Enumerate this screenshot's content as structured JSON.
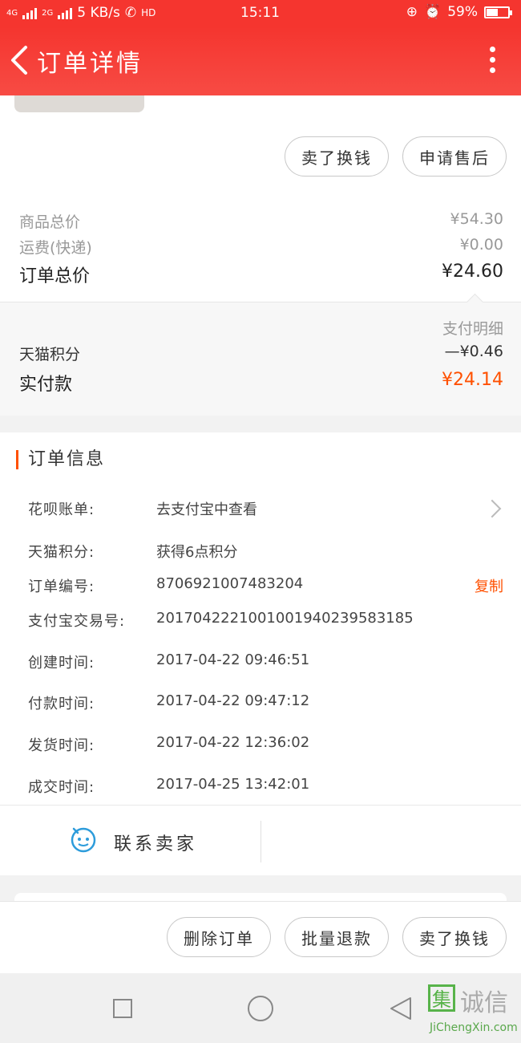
{
  "status": {
    "net": "4G",
    "net2": "2G",
    "speed": "5 KB/s",
    "hd": "HD",
    "time": "15:11",
    "battery": "59%",
    "battery_level": 0.59
  },
  "nav": {
    "title": "订单详情"
  },
  "actions_top": {
    "sell": "卖了换钱",
    "after_sale": "申请售后"
  },
  "prices": {
    "goods_total_label": "商品总价",
    "goods_total": "¥54.30",
    "shipping_label": "运费(快递)",
    "shipping": "¥0.00",
    "order_total_label": "订单总价",
    "order_total": "¥24.60"
  },
  "payment": {
    "detail_link": "支付明细",
    "points_label": "天猫积分",
    "points_value": "—¥0.46",
    "paid_label": "实付款",
    "paid_value": "¥24.14"
  },
  "order_info": {
    "title": "订单信息",
    "rows": [
      {
        "key": "花呗账单:",
        "value": "去支付宝中查看"
      },
      {
        "key": "天猫积分:",
        "value": "获得6点积分"
      },
      {
        "key": "订单编号:",
        "value": "870692100748320​4"
      },
      {
        "key": "支付宝交易号:",
        "value": "2017042221001001940239583185"
      },
      {
        "key": "创建时间:",
        "value": "2017-04-22 09:46:51"
      },
      {
        "key": "付款时间:",
        "value": "2017-04-22 09:47:12"
      },
      {
        "key": "发货时间:",
        "value": "2017-04-22 12:36:02"
      },
      {
        "key": "成交时间:",
        "value": "2017-04-25 13:42:01"
      }
    ],
    "copy_label": "复制",
    "contact_label": "联系卖家"
  },
  "actions_bottom": {
    "delete": "删除订单",
    "batch_refund": "批量退款",
    "sell": "卖了换钱"
  },
  "watermark": {
    "box": "集",
    "text": "诚信",
    "sub": "JiChengXin.com"
  },
  "colors": {
    "brand": "#f5352f",
    "accent": "#ff5000"
  }
}
